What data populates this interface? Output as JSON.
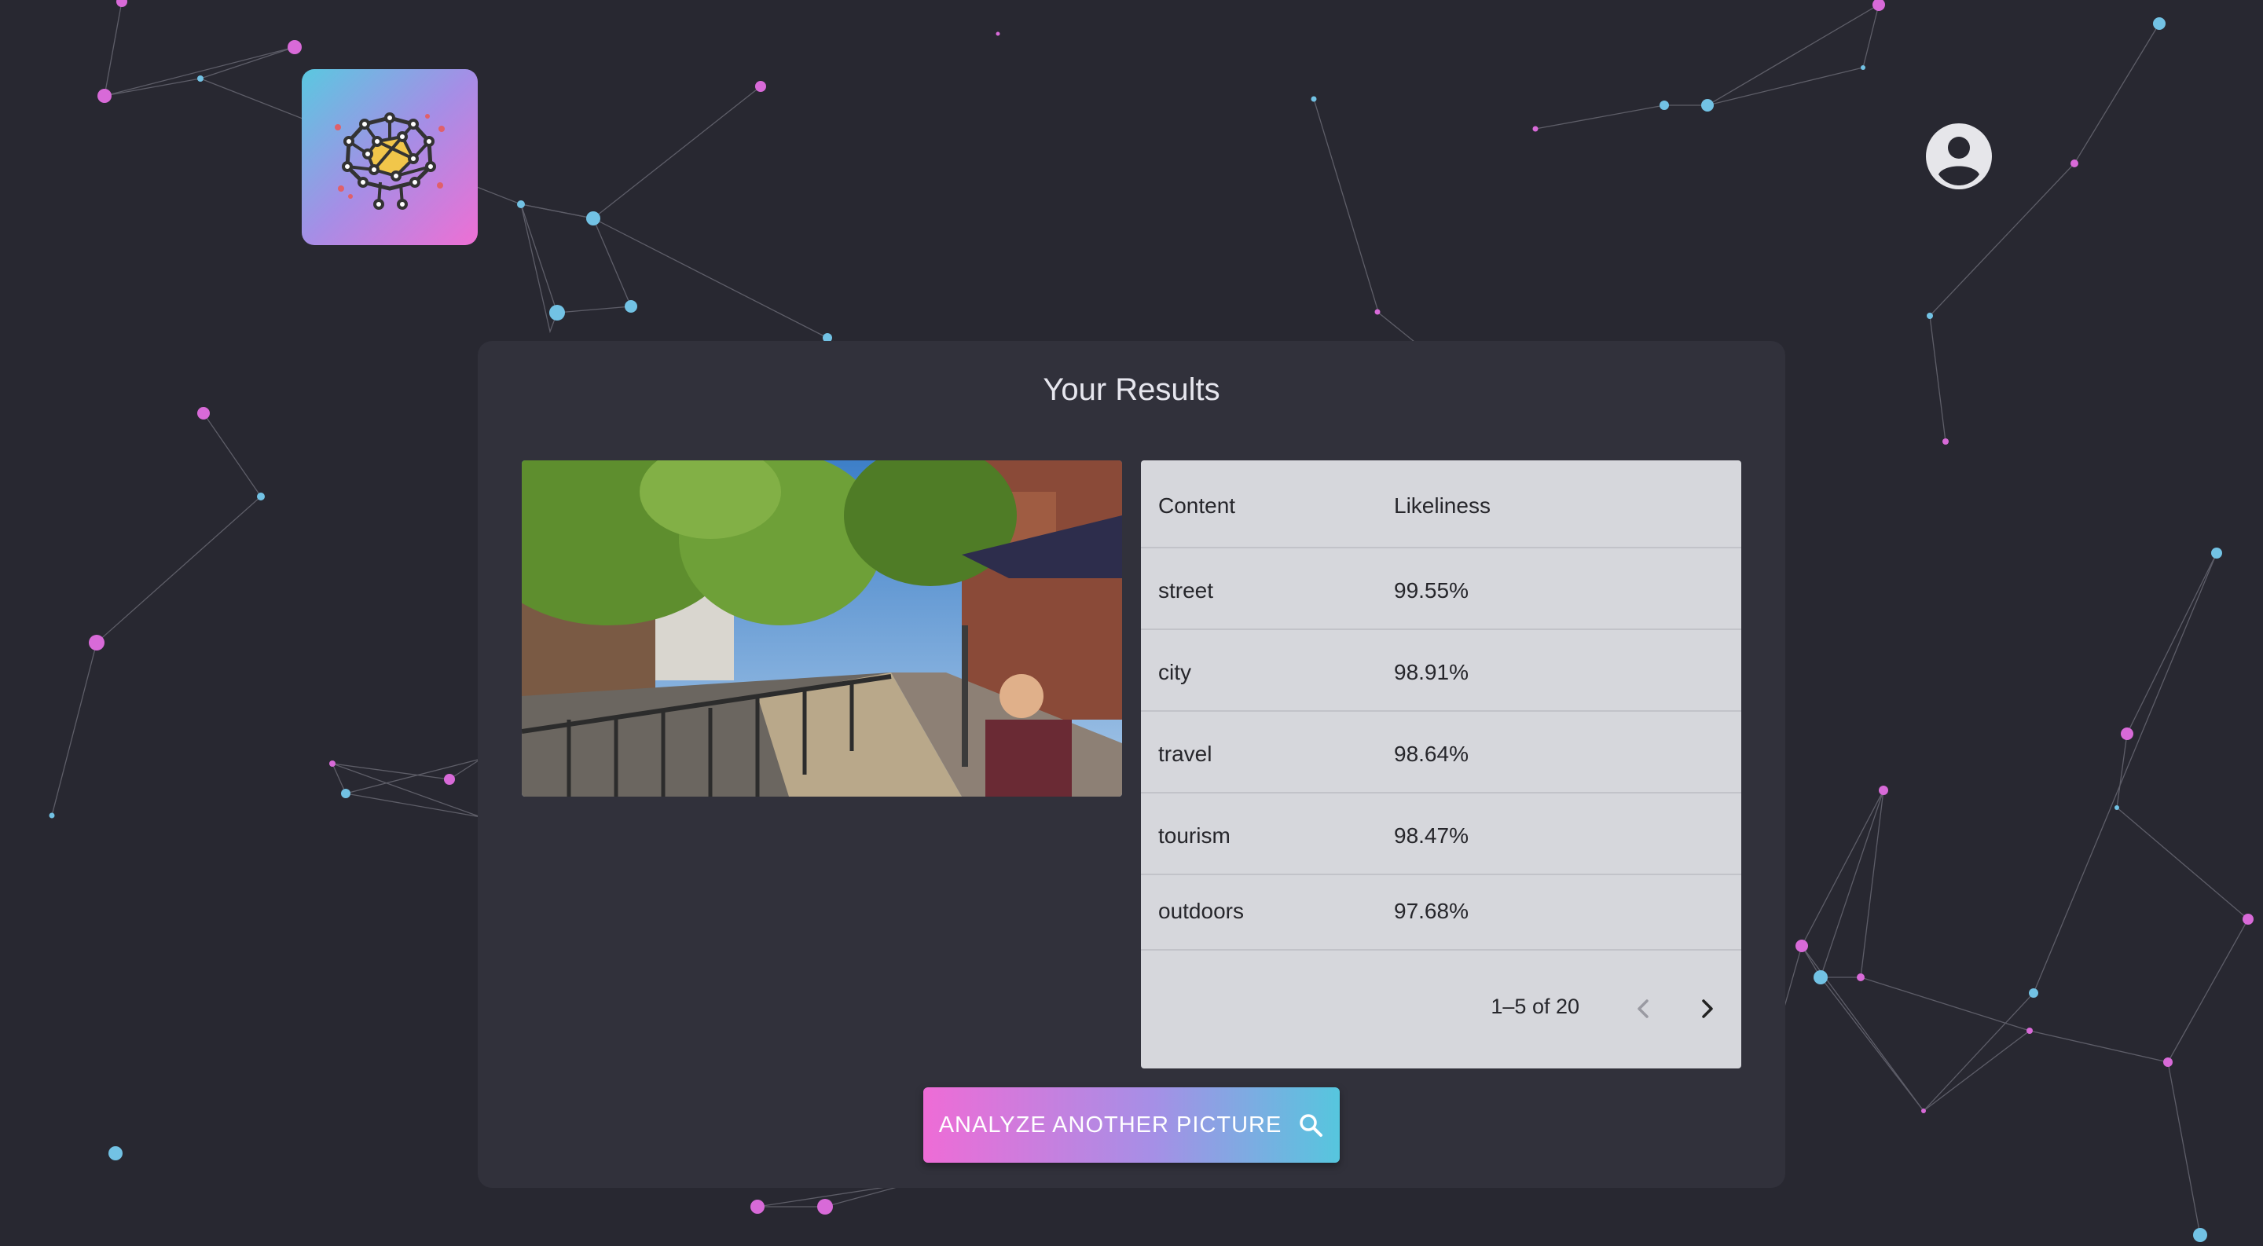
{
  "app": {
    "logo_icon": "brain-network-icon",
    "profile_icon": "account-circle-icon",
    "accent_pink": "#ee6cd6",
    "accent_cyan": "#56c6de",
    "background": "#282831"
  },
  "results": {
    "title": "Your Results",
    "image_description": "street photo",
    "table": {
      "columns": [
        "Content",
        "Likeliness"
      ],
      "rows": [
        {
          "content": "street",
          "likeliness": "99.55%"
        },
        {
          "content": "city",
          "likeliness": "98.91%"
        },
        {
          "content": "travel",
          "likeliness": "98.64%"
        },
        {
          "content": "tourism",
          "likeliness": "98.47%"
        },
        {
          "content": "outdoors",
          "likeliness": "97.68%"
        }
      ],
      "pagination": {
        "range": "1–5 of 20",
        "prev_icon": "chevron-left-icon",
        "next_icon": "chevron-right-icon"
      }
    },
    "cta": {
      "label": "ANALYZE ANOTHER PICTURE",
      "icon": "search-icon"
    }
  }
}
